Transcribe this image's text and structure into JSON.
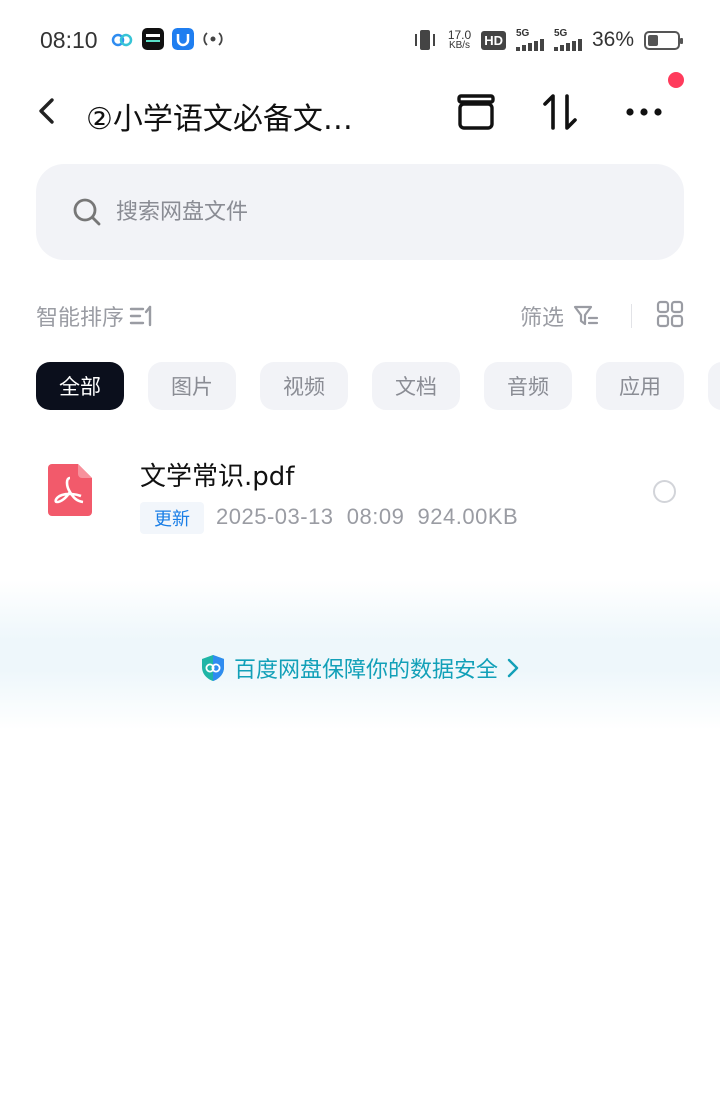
{
  "status_bar": {
    "time": "08:10",
    "net_speed_value": "17.0",
    "net_speed_unit": "KB/s",
    "hd": "HD",
    "signal_1": "5G",
    "signal_2": "5G",
    "battery_text": "36%",
    "battery_level": 0.36
  },
  "header": {
    "title": "②小学语文必备文…",
    "icons": [
      "back-icon",
      "archive-icon",
      "sort-arrows-icon",
      "more-icon"
    ]
  },
  "search": {
    "placeholder": "搜索网盘文件"
  },
  "toolbar": {
    "sort_label": "智能排序",
    "filter_label": "筛选"
  },
  "chips": [
    {
      "label": "全部",
      "active": true
    },
    {
      "label": "图片",
      "active": false
    },
    {
      "label": "视频",
      "active": false
    },
    {
      "label": "文档",
      "active": false
    },
    {
      "label": "音频",
      "active": false
    },
    {
      "label": "应用",
      "active": false
    }
  ],
  "files": [
    {
      "name": "文学常识.pdf",
      "badge": "更新",
      "meta": "2025-03-13  08:09  924.00KB",
      "icon": "pdf-icon"
    }
  ],
  "security_banner": {
    "text": "百度网盘保障你的数据安全"
  },
  "colors": {
    "chip_active_bg": "#0b0f1c",
    "accent_blue": "#1a7ee6",
    "security_teal": "#12a0b8",
    "pdf_red": "#f25a6b",
    "notification_red": "#ff3b5c"
  }
}
